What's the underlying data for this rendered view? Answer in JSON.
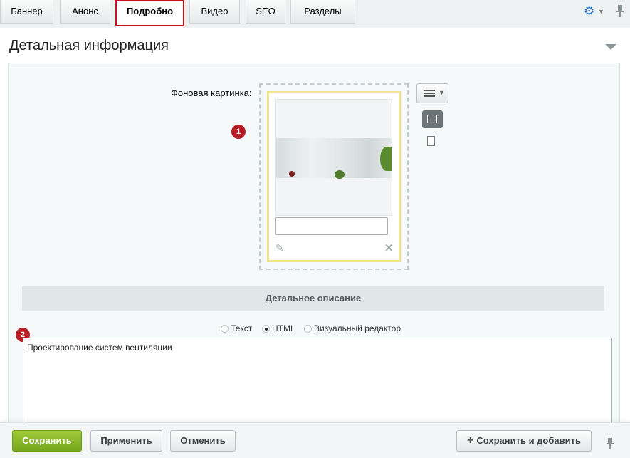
{
  "tabs": [
    {
      "label": "Баннер"
    },
    {
      "label": "Анонс"
    },
    {
      "label": "Подробно"
    },
    {
      "label": "Видео"
    },
    {
      "label": "SEO"
    },
    {
      "label": "Разделы"
    }
  ],
  "section": {
    "title": "Детальная информация"
  },
  "background_image": {
    "label": "Фоновая картинка:",
    "description_value": ""
  },
  "badges": {
    "one": "1",
    "two": "2"
  },
  "detail": {
    "header": "Детальное описание",
    "radio_options": [
      {
        "label": "Текст",
        "selected": false
      },
      {
        "label": "HTML",
        "selected": true
      },
      {
        "label": "Визуальный редактор",
        "selected": false
      }
    ],
    "editor_text": "Проектирование систем вентиляции"
  },
  "footer": {
    "save": "Сохранить",
    "apply": "Применить",
    "cancel": "Отменить",
    "save_add": "Сохранить и добавить"
  },
  "colors": {
    "accent_green": "#86b727",
    "highlight_red": "#c4141c",
    "badge_red": "#b71e25",
    "gear_blue": "#2a72c2"
  }
}
